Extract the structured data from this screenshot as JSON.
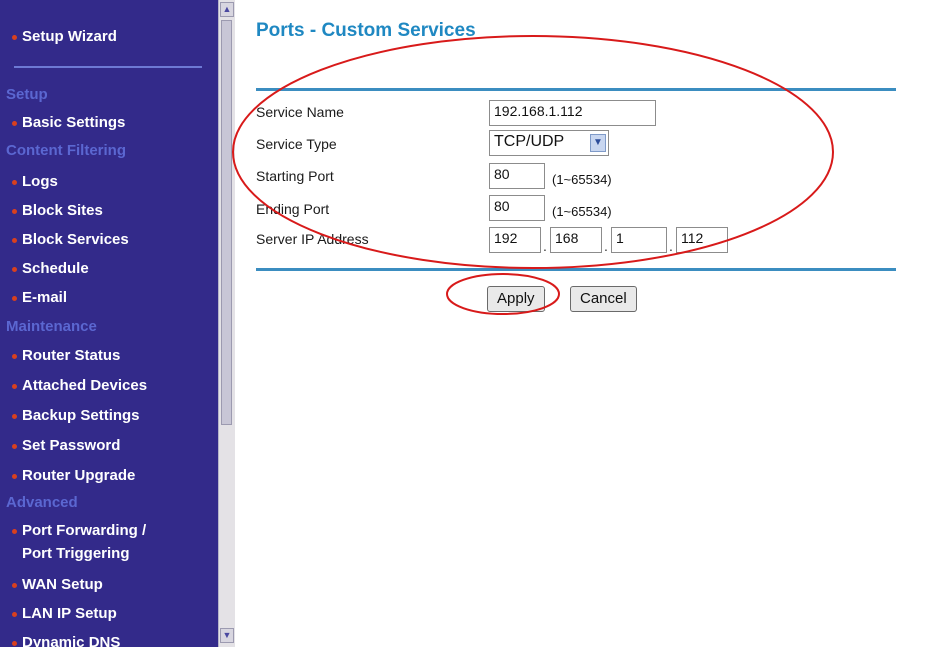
{
  "sidebar": {
    "top": "Setup Wizard",
    "sections": [
      {
        "heading": "Setup",
        "items": [
          "Basic Settings"
        ]
      },
      {
        "heading": "Content Filtering",
        "items": [
          "Logs",
          "Block Sites",
          "Block Services",
          "Schedule",
          "E-mail"
        ]
      },
      {
        "heading": "Maintenance",
        "items": [
          "Router Status",
          "Attached Devices",
          "Backup Settings",
          "Set Password",
          "Router Upgrade"
        ]
      },
      {
        "heading": "Advanced",
        "items": [
          "Port Forwarding /",
          "Port Triggering",
          "WAN Setup",
          "LAN IP Setup",
          "Dynamic DNS"
        ]
      }
    ]
  },
  "page": {
    "title": "Ports - Custom Services"
  },
  "form": {
    "service_name_label": "Service Name",
    "service_name_value": "192.168.1.112",
    "service_type_label": "Service Type",
    "service_type_value": "TCP/UDP",
    "starting_port_label": "Starting Port",
    "starting_port_value": "80",
    "starting_port_hint": "(1~65534)",
    "ending_port_label": "Ending Port",
    "ending_port_value": "80",
    "ending_port_hint": "(1~65534)",
    "server_ip_label": "Server IP Address",
    "server_ip_octets": [
      "192",
      "168",
      "1",
      "112"
    ]
  },
  "buttons": {
    "apply": "Apply",
    "cancel": "Cancel"
  },
  "colors": {
    "sidebar_bg": "#332a8a",
    "heading": "#5b67d1",
    "title": "#1f88c2",
    "rule": "#3b8dc0",
    "bullet": "#d9401e",
    "annotation": "#d81a1a"
  },
  "icons": {
    "scroll_up": "▲",
    "scroll_down": "▼",
    "dropdown": "▼"
  }
}
